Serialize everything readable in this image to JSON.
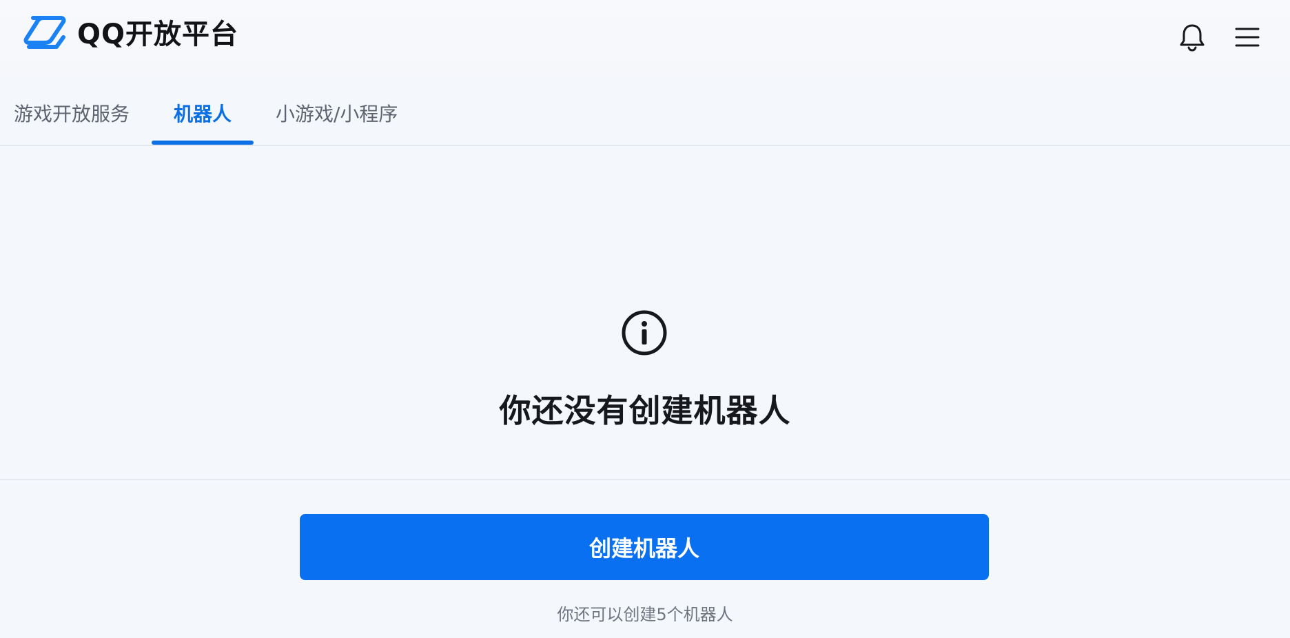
{
  "header": {
    "logo_text": "QQ开放平台",
    "logo_icon": "qq-open-platform-logo-icon",
    "notification_icon": "bell-icon",
    "menu_icon": "hamburger-menu-icon"
  },
  "tabs": [
    {
      "label": "游戏开放服务",
      "active": false
    },
    {
      "label": "机器人",
      "active": true
    },
    {
      "label": "小游戏/小程序",
      "active": false
    }
  ],
  "empty_state": {
    "icon": "info-circle-icon",
    "title": "你还没有创建机器人"
  },
  "actions": {
    "create_label": "创建机器人",
    "remaining_text": "你还可以创建5个机器人"
  },
  "colors": {
    "accent": "#0b6fe6",
    "button": "#0970f1",
    "background": "#f4f7fc"
  }
}
